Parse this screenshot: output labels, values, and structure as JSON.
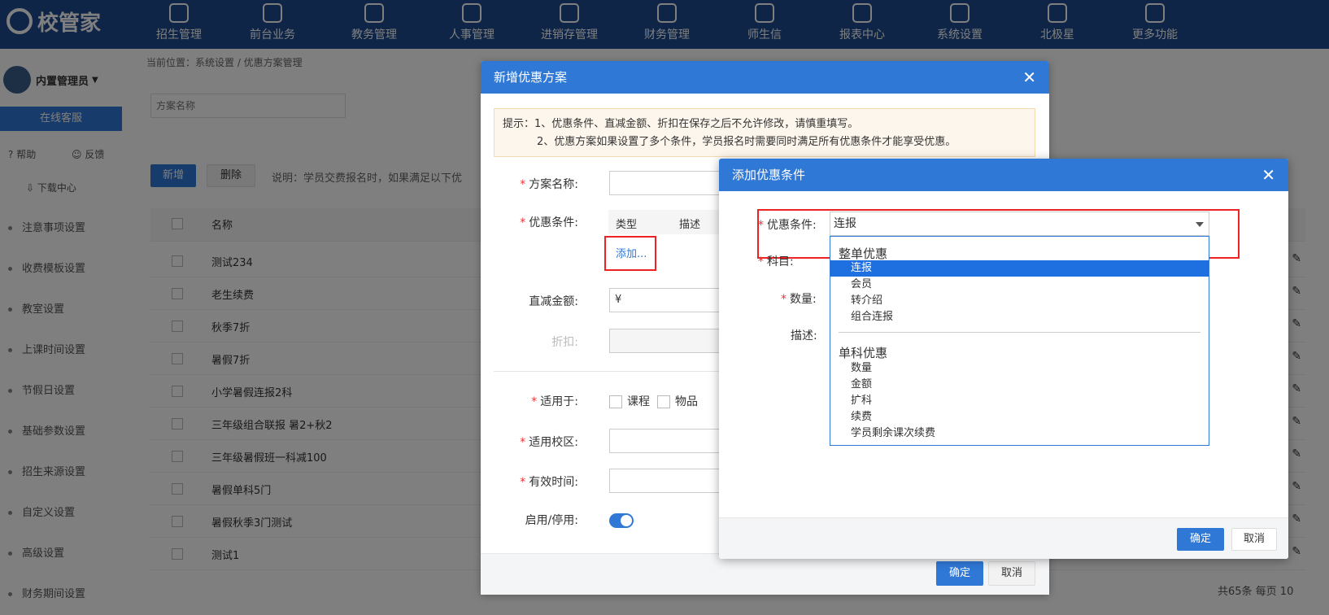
{
  "app": {
    "logo_text": "校管家"
  },
  "topnav": {
    "items": [
      {
        "label": "招生管理",
        "icon": "person-add-icon"
      },
      {
        "label": "前台业务",
        "icon": "monitor-icon"
      },
      {
        "label": "教务管理",
        "icon": "book-icon"
      },
      {
        "label": "人事管理",
        "icon": "user-icon"
      },
      {
        "label": "进销存管理",
        "icon": "inventory-icon"
      },
      {
        "label": "财务管理",
        "icon": "finance-icon"
      },
      {
        "label": "师生信",
        "icon": "chat-icon"
      },
      {
        "label": "报表中心",
        "icon": "report-icon"
      },
      {
        "label": "系统设置",
        "icon": "gear-icon"
      },
      {
        "label": "北极星",
        "icon": "star-icon"
      },
      {
        "label": "更多功能",
        "icon": "more-icon"
      }
    ]
  },
  "sidebar": {
    "user_name": "内置管理员",
    "online_btn": "在线客服",
    "help": "帮助",
    "feedback": "反馈",
    "download": "下载中心",
    "menu": [
      "注意事项设置",
      "收费模板设置",
      "教室设置",
      "上课时间设置",
      "节假日设置",
      "基础参数设置",
      "招生来源设置",
      "自定义设置",
      "高级设置",
      "财务期间设置"
    ]
  },
  "main": {
    "breadcrumb": "当前位置：系统设置 / 优惠方案管理",
    "search_placeholder": "方案名称",
    "add_btn": "新增",
    "delete_btn": "删除",
    "note": "说明：学员交费报名时，如果满足以下优",
    "col_name": "名称",
    "rows": [
      "测试234",
      "老生续费",
      "秋季7折",
      "暑假7折",
      "小学暑假连报2科",
      "三年级组合联报 暑2+秋2",
      "三年级暑假班一科减100",
      "暑假单科5门",
      "暑假秋季3门测试",
      "测试1"
    ],
    "pager": "共65条  每页  10"
  },
  "dialog1": {
    "title": "新增优惠方案",
    "tip_line1": "提示：1、优惠条件、直减金额、折扣在保存之后不允许修改，请慎重填写。",
    "tip_line2": "2、优惠方案如果设置了多个条件，学员报名时需要同时满足所有优惠条件才能享受优惠。",
    "label_name": "方案名称:",
    "label_condition": "优惠条件:",
    "th_type": "类型",
    "th_desc": "描述",
    "add_link": "添加...",
    "label_amount": "直减金额:",
    "amount_prefix": "¥",
    "label_discount": "折扣:",
    "label_apply": "适用于:",
    "apply_course": "课程",
    "apply_goods": "物品",
    "label_campus": "适用校区:",
    "label_valid": "有效时间:",
    "label_enable": "启用/停用:",
    "enabled": true,
    "confirm": "确定",
    "cancel": "取消"
  },
  "dialog2": {
    "title": "添加优惠条件",
    "label_condition": "优惠条件:",
    "selected_value": "连报",
    "label_subject": "科目:",
    "label_qty": "数量:",
    "label_desc": "描述:",
    "groups": [
      {
        "name": "整单优惠",
        "options": [
          "连报",
          "会员",
          "转介绍",
          "组合连报"
        ]
      },
      {
        "name": "单科优惠",
        "options": [
          "数量",
          "金额",
          "扩科",
          "续费",
          "学员剩余课次续费"
        ]
      }
    ],
    "highlighted_option": "连报",
    "confirm": "确定",
    "cancel": "取消"
  },
  "colors": {
    "nav_bg": "#1d4b8f",
    "primary": "#2f78d6",
    "highlight_box": "#e22222"
  }
}
